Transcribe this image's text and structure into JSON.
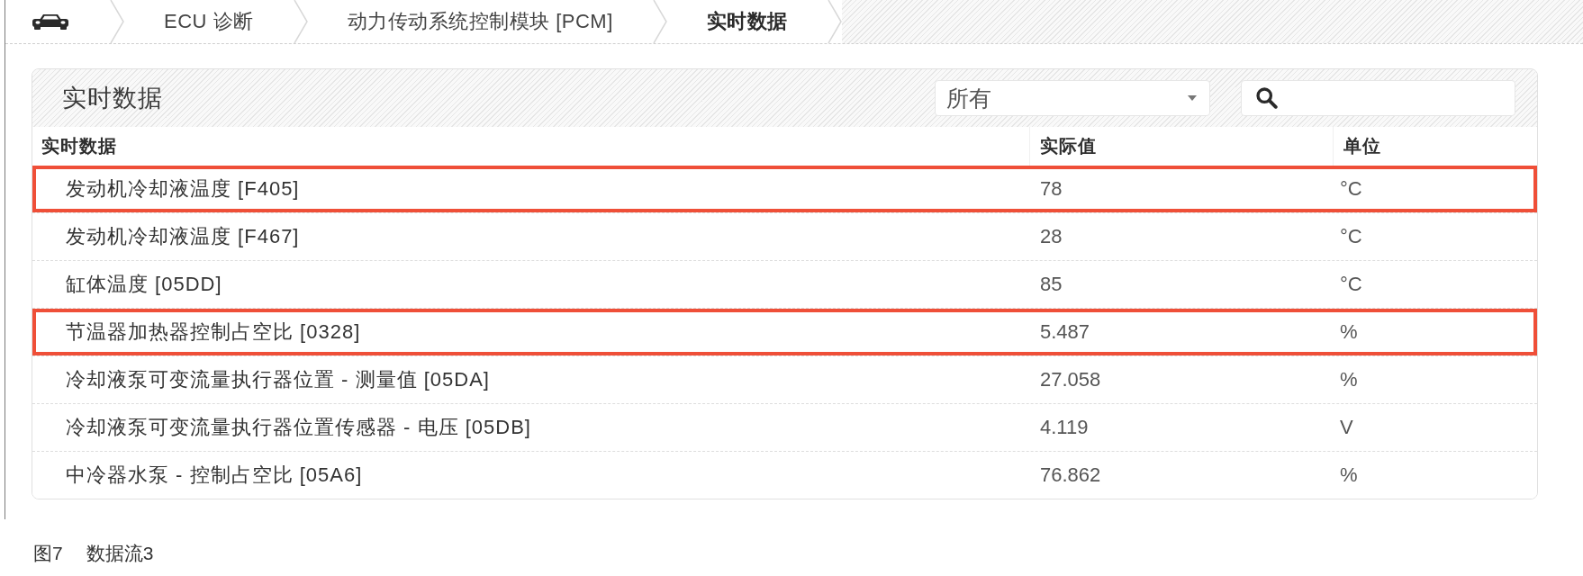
{
  "breadcrumb": [
    {
      "label": "ECU 诊断",
      "selected": false
    },
    {
      "label": "动力传动系统控制模块 [PCM]",
      "selected": false
    },
    {
      "label": "实时数据",
      "selected": true
    }
  ],
  "panel": {
    "title": "实时数据",
    "filter": {
      "value": "所有"
    }
  },
  "table": {
    "columns": [
      "实时数据",
      "实际值",
      "单位"
    ],
    "rows": [
      {
        "name": "发动机冷却液温度 [F405]",
        "value": "78",
        "unit": "°C",
        "highlighted": true
      },
      {
        "name": "发动机冷却液温度 [F467]",
        "value": "28",
        "unit": "°C",
        "highlighted": false
      },
      {
        "name": "缸体温度 [05DD]",
        "value": "85",
        "unit": "°C",
        "highlighted": false
      },
      {
        "name": "节温器加热器控制占空比 [0328]",
        "value": "5.487",
        "unit": "%",
        "highlighted": true
      },
      {
        "name": "冷却液泵可变流量执行器位置 - 测量值 [05DA]",
        "value": "27.058",
        "unit": "%",
        "highlighted": false
      },
      {
        "name": "冷却液泵可变流量执行器位置传感器 - 电压 [05DB]",
        "value": "4.119",
        "unit": "V",
        "highlighted": false
      },
      {
        "name": "中冷器水泵 - 控制占空比 [05A6]",
        "value": "76.862",
        "unit": "%",
        "highlighted": false
      }
    ]
  },
  "caption": {
    "label": "图7",
    "title": "数据流3"
  }
}
